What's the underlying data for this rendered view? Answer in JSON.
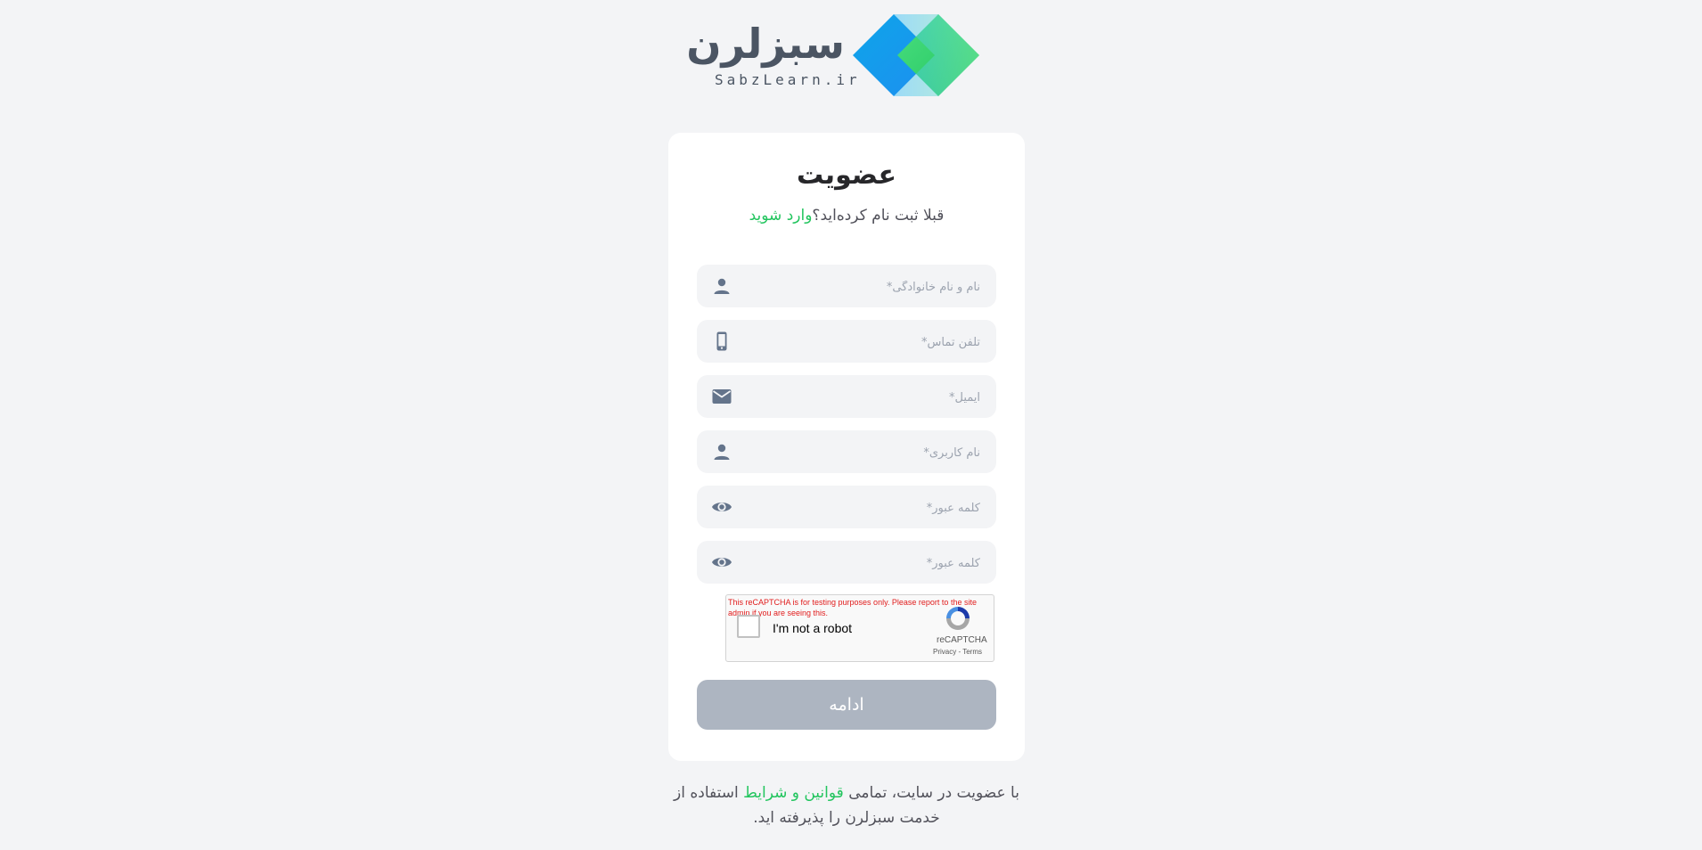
{
  "brand": {
    "name_fa": "سبزلرن",
    "name_en": "SabzLearn.ir"
  },
  "form": {
    "title": "عضویت",
    "subtitle": "قبلا ثبت نام کرده‌اید؟",
    "login_link": "وارد شوید",
    "fields": [
      {
        "placeholder": "نام و نام خانوادگی*",
        "icon": "user-icon"
      },
      {
        "placeholder": "تلفن تماس*",
        "icon": "phone-icon"
      },
      {
        "placeholder": "ایمیل*",
        "icon": "mail-icon"
      },
      {
        "placeholder": "نام کاربری*",
        "icon": "user-icon"
      },
      {
        "placeholder": "کلمه عبور*",
        "icon": "eye-icon"
      },
      {
        "placeholder": "کلمه عبور*",
        "icon": "eye-icon"
      }
    ],
    "submit_label": "ادامه",
    "submit_color": "#adb5c1"
  },
  "recaptcha": {
    "warning": "This reCAPTCHA is for testing purposes only. Please report to the site admin if you are seeing this.",
    "checkbox_label": "I'm not a robot",
    "brand": "reCAPTCHA",
    "privacy": "Privacy",
    "separator": "-",
    "terms": "Terms"
  },
  "footer": {
    "text_before": "با عضویت در سایت، تمامی ",
    "link": "قوانین و شرایط",
    "text_after": " استفاده از خدمت سبزلرن را پذیرفته اید."
  },
  "colors": {
    "accent": "#22c55e",
    "background": "#f3f4f6",
    "card": "#ffffff"
  }
}
